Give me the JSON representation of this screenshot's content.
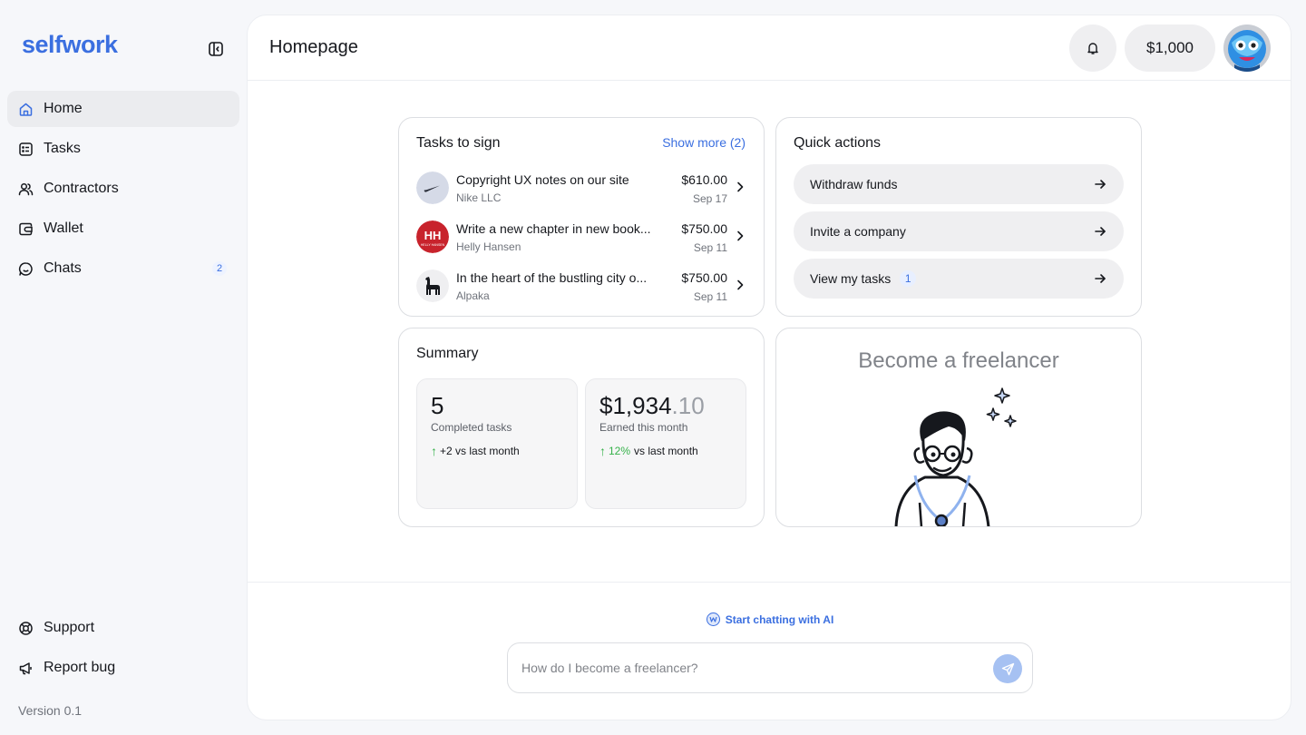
{
  "app": {
    "logo_text": "selfwork"
  },
  "sidebar": {
    "items": [
      {
        "label": "Home",
        "icon": "home-icon",
        "active": true
      },
      {
        "label": "Tasks",
        "icon": "tasks-icon"
      },
      {
        "label": "Contractors",
        "icon": "users-icon"
      },
      {
        "label": "Wallet",
        "icon": "wallet-icon"
      },
      {
        "label": "Chats",
        "icon": "chat-icon",
        "badge": "2"
      }
    ],
    "bottom_items": [
      {
        "label": "Support",
        "icon": "lifebuoy-icon"
      },
      {
        "label": "Report bug",
        "icon": "megaphone-icon"
      }
    ],
    "version": "Version 0.1"
  },
  "header": {
    "title": "Homepage",
    "balance": "$1,000"
  },
  "tasks_to_sign": {
    "title": "Tasks to sign",
    "show_more": "Show more (2)",
    "items": [
      {
        "name": "Copyright UX notes on our site",
        "company": "Nike LLC",
        "amount": "$610.00",
        "date": "Sep 17"
      },
      {
        "name": "Write a new chapter in new book...",
        "company": "Helly Hansen",
        "amount": "$750.00",
        "date": "Sep 11"
      },
      {
        "name": "In the heart of the bustling city o...",
        "company": "Alpaka",
        "amount": "$750.00",
        "date": "Sep 11"
      }
    ]
  },
  "quick_actions": {
    "title": "Quick actions",
    "items": [
      {
        "label": "Withdraw funds"
      },
      {
        "label": "Invite a company"
      },
      {
        "label": "View my tasks",
        "badge": "1"
      }
    ]
  },
  "summary": {
    "title": "Summary",
    "completed": {
      "value": "5",
      "label": "Completed tasks",
      "trend": "+2 vs last month"
    },
    "earned": {
      "value_main": "$1,934",
      "value_decimal": ".10",
      "label": "Earned this month",
      "trend_pct": "12%",
      "trend_text": "vs last month"
    }
  },
  "freelancer_card": {
    "title": "Become a freelancer"
  },
  "chat": {
    "link_label": "Start chatting with AI",
    "placeholder": "How do I become a freelancer?"
  },
  "colors": {
    "accent": "#3b6fe0",
    "positive": "#36b24a",
    "nav_active_bg": "#ebecef"
  }
}
